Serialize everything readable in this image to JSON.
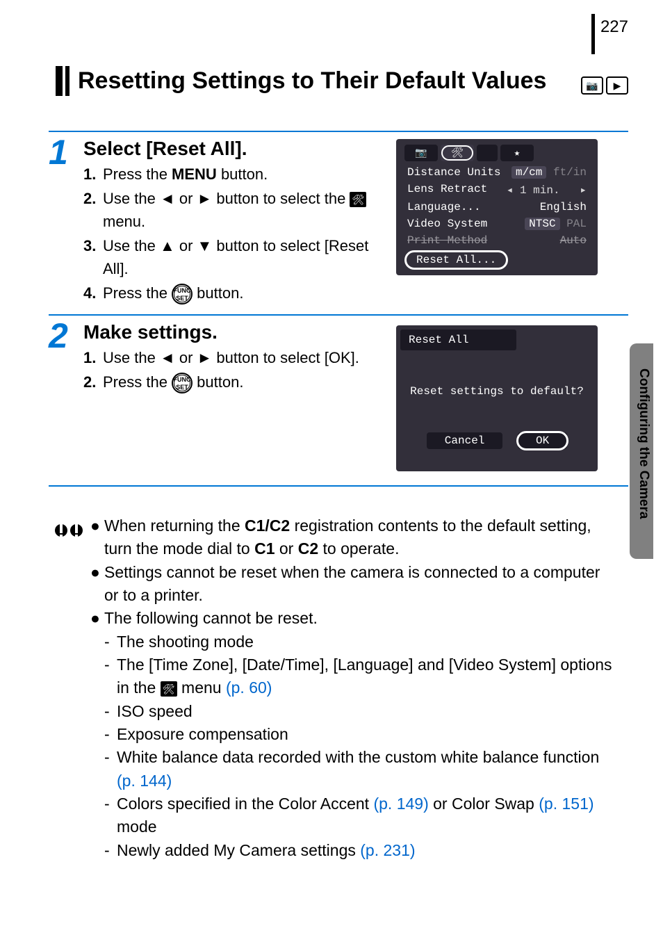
{
  "page_number": "227",
  "title": "Resetting Settings to Their Default Values",
  "side_label": "Configuring the Camera",
  "step1": {
    "num": "1",
    "heading": "Select [Reset All].",
    "items": [
      {
        "n": "1.",
        "pre": "Press the ",
        "bold": "MENU",
        "post": " button."
      },
      {
        "n": "2.",
        "pre": "Use the ",
        "mid": " or ",
        "post": " button to select the ",
        "tail": " menu."
      },
      {
        "n": "3.",
        "pre": "Use the ",
        "mid": " or ",
        "post": " button to select [Reset All]."
      },
      {
        "n": "4.",
        "pre": "Press the ",
        "post": " button."
      }
    ]
  },
  "step2": {
    "num": "2",
    "heading": "Make settings.",
    "items": [
      {
        "n": "1.",
        "pre": "Use the ",
        "mid": " or ",
        "post": " button to select [OK]."
      },
      {
        "n": "2.",
        "pre": "Press the ",
        "post": " button."
      }
    ]
  },
  "screenshot1": {
    "rows": [
      {
        "label": "Distance Units",
        "value": "m/cm",
        "dim": "ft/in"
      },
      {
        "label": "Lens Retract",
        "value": "1 min."
      },
      {
        "label": "Language...",
        "value": "English"
      },
      {
        "label": "Video System",
        "value": "NTSC",
        "dim": "PAL"
      },
      {
        "label": "Print Method",
        "value": "Auto"
      }
    ],
    "highlight": "Reset All..."
  },
  "screenshot2": {
    "title": "Reset All",
    "message": "Reset settings to default?",
    "cancel": "Cancel",
    "ok": "OK"
  },
  "notes": {
    "n1a": "When returning the ",
    "n1b": " registration contents to the default setting, turn the mode dial to ",
    "n1c": " or ",
    "n1d": " to operate.",
    "n2": "Settings cannot be reset when the camera is connected to a computer or to a printer.",
    "n3": "The following cannot be reset.",
    "d1": "The shooting mode",
    "d2a": "The [Time Zone], [Date/Time], [Language] and [Video System] options in the ",
    "d2b": " menu ",
    "d2link": "(p. 60)",
    "d3": "ISO speed",
    "d4": "Exposure compensation",
    "d5a": "White balance data recorded with the custom white balance function ",
    "d5link": "(p. 144)",
    "d6a": "Colors specified in the Color Accent ",
    "d6link1": "(p. 149)",
    "d6b": " or Color Swap ",
    "d6link2": "(p. 151)",
    "d6c": " mode",
    "d7a": "Newly added My Camera settings ",
    "d7link": "(p. 231)"
  },
  "glyphs": {
    "c1": "C1",
    "c2": "C2",
    "c1c2": "C1/C2",
    "func_top": "FUNC",
    "func_bot": "SET",
    "left": "◄",
    "right": "►",
    "up": "▲",
    "down": "▼",
    "tool": "🛠",
    "camera": "📷",
    "play": "▶",
    "star": "★"
  }
}
